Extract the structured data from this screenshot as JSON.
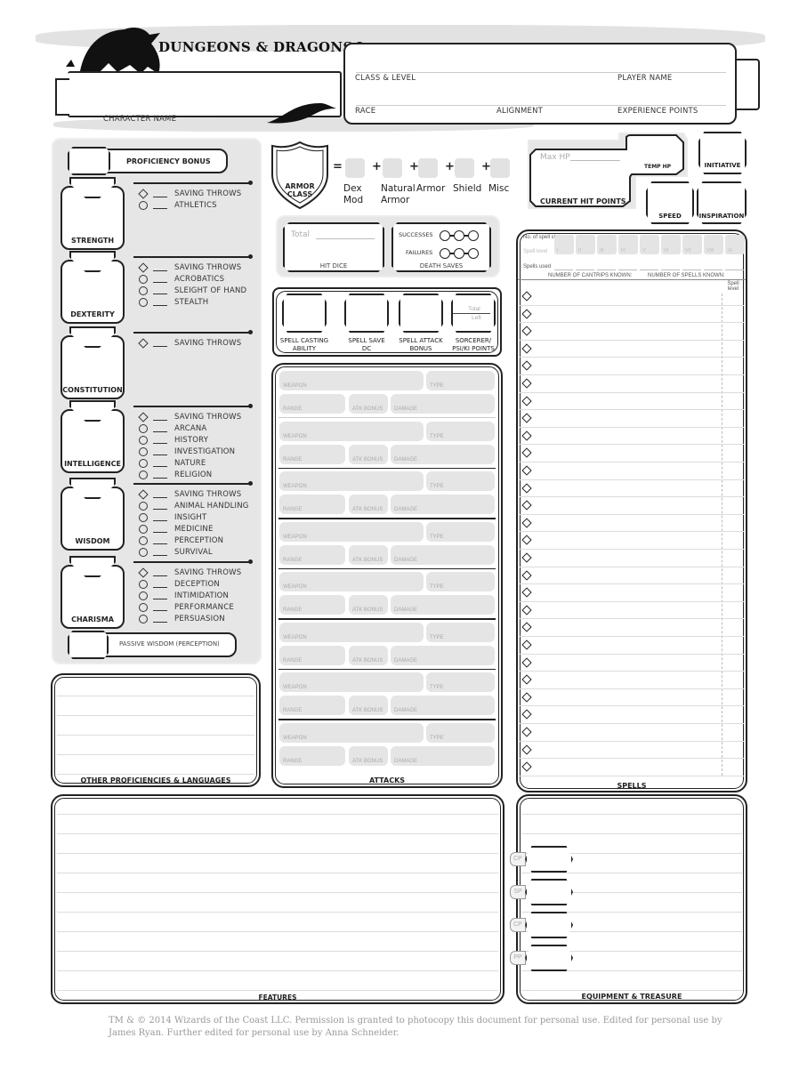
{
  "header": {
    "logo": "DUNGEONS & DRAGONS®",
    "character_name_label": "CHARACTER NAME",
    "class_level_label": "CLASS & LEVEL",
    "player_name_label": "PLAYER NAME",
    "race_label": "RACE",
    "alignment_label": "ALIGNMENT",
    "experience_label": "EXPERIENCE POINTS"
  },
  "proficiency_bonus_label": "PROFICIENCY BONUS",
  "abilities": [
    {
      "name": "STRENGTH",
      "skills": [
        "SAVING THROWS",
        "ATHLETICS"
      ]
    },
    {
      "name": "DEXTERITY",
      "skills": [
        "SAVING THROWS",
        "ACROBATICS",
        "SLEIGHT OF HAND",
        "STEALTH"
      ]
    },
    {
      "name": "CONSTITUTION",
      "skills": [
        "SAVING THROWS"
      ]
    },
    {
      "name": "INTELLIGENCE",
      "skills": [
        "SAVING THROWS",
        "ARCANA",
        "HISTORY",
        "INVESTIGATION",
        "NATURE",
        "RELIGION"
      ]
    },
    {
      "name": "WISDOM",
      "skills": [
        "SAVING THROWS",
        "ANIMAL HANDLING",
        "INSIGHT",
        "MEDICINE",
        "PERCEPTION",
        "SURVIVAL"
      ]
    },
    {
      "name": "CHARISMA",
      "skills": [
        "SAVING THROWS",
        "DECEPTION",
        "INTIMIDATION",
        "PERFORMANCE",
        "PERSUASION"
      ]
    }
  ],
  "passive_wisdom_label": "PASSIVE WISDOM (PERCEPTION)",
  "armor_class": {
    "label_line1": "ARMOR",
    "label_line2": "CLASS",
    "equals": "=",
    "plus": "+",
    "components": [
      {
        "line1": "Dex",
        "line2": "Mod"
      },
      {
        "line1": "Natural",
        "line2": "Armor"
      },
      {
        "line1": "Armor",
        "line2": ""
      },
      {
        "line1": "Shield",
        "line2": ""
      },
      {
        "line1": "Misc",
        "line2": ""
      }
    ]
  },
  "hit_dice": {
    "total_label": "Total",
    "label": "HIT DICE"
  },
  "death_saves": {
    "successes_label": "SUCCESSES",
    "failures_label": "FAILURES",
    "label": "DEATH SAVES"
  },
  "spell_stats": [
    {
      "line1": "SPELL CASTING",
      "line2": "ABILITY"
    },
    {
      "line1": "SPELL SAVE",
      "line2": "DC"
    },
    {
      "line1": "SPELL ATTACK",
      "line2": "BONUS"
    },
    {
      "line1": "SORCERER/",
      "line2": "PSI/KI POINTS"
    }
  ],
  "points_total_label": "Total",
  "points_left_label": "Left",
  "hp": {
    "max_label": "Max HP",
    "current_label": "CURRENT HIT POINTS",
    "temp_label": "TEMP HP"
  },
  "initiative_label": "INITIATIVE",
  "speed_label": "SPEED",
  "inspiration_label": "INSPIRATION",
  "spell_slots": {
    "no_slots_label": "No. of spell slots",
    "spell_level_label": "Spell level",
    "levels": [
      "I",
      "II",
      "III",
      "IV",
      "V",
      "VI",
      "VII",
      "VIII",
      "IX"
    ],
    "spells_used_label": "Spells used",
    "cantrips_known_label": "NUMBER OF CANTRIPS KNOWN:",
    "spells_known_label": "NUMBER OF SPELLS KNOWN:",
    "spell_level_col": "Spell level",
    "rows": 28,
    "label": "SPELLS"
  },
  "attacks": {
    "weapon_label": "WEAPON",
    "type_label": "TYPE",
    "range_label": "RANGE",
    "atk_bonus_label": "ATK BONUS",
    "damage_label": "DAMAGE",
    "count": 8,
    "label": "ATTACKS"
  },
  "other_proficiencies_label": "OTHER PROFICIENCIES & LANGUAGES",
  "features_label": "FEATURES",
  "equipment": {
    "label": "EQUIPMENT & TREASURE",
    "coins": [
      "CP",
      "SP",
      "CP",
      "PP"
    ]
  },
  "footer": "TM & © 2014 Wizards of the Coast LLC. Permission is granted to photocopy this document for personal use. Edited for personal use by James Ryan. Further edited for personal use by Anna Schneider."
}
